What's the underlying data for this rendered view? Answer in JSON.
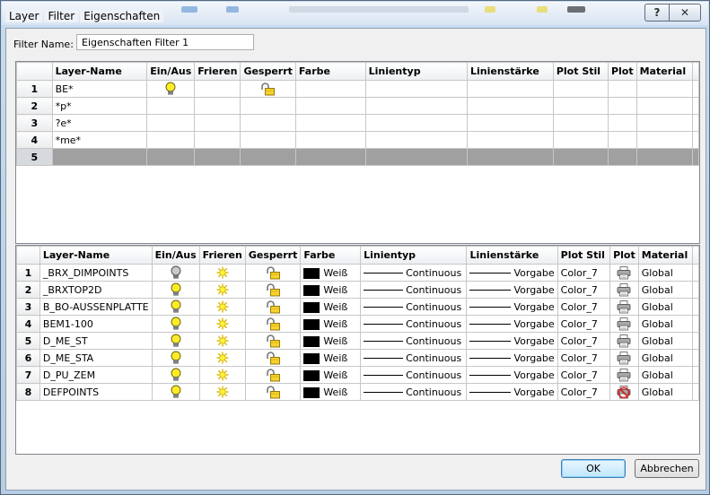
{
  "window": {
    "menu": [
      "Layer",
      "Filter",
      "Eigenschaften"
    ],
    "help_glyph": "?",
    "close_glyph": "✕"
  },
  "filter": {
    "label": "Filter Name:",
    "value": "Eigenschaften Filter 1"
  },
  "columns": [
    "Layer-Name",
    "Ein/Aus",
    "Frieren",
    "Gesperrt",
    "Farbe",
    "Linientyp",
    "Linienstärke",
    "Plot Stil",
    "Plot",
    "Material"
  ],
  "filter_rows": [
    {
      "num": "1",
      "name": "BE*",
      "on": true,
      "locked": true
    },
    {
      "num": "2",
      "name": "*p*"
    },
    {
      "num": "3",
      "name": "?e*"
    },
    {
      "num": "4",
      "name": "*me*"
    },
    {
      "num": "5",
      "name": "",
      "selected": true
    }
  ],
  "layers": [
    {
      "num": "1",
      "name": "_BRX_DIMPOINTS",
      "on": false,
      "color": "Weiß",
      "linetype": "Continuous",
      "lineweight": "Vorgabe",
      "plotstyle": "Color_7",
      "plot": true,
      "material": "Global"
    },
    {
      "num": "2",
      "name": "_BRXTOP2D",
      "on": true,
      "color": "Weiß",
      "linetype": "Continuous",
      "lineweight": "Vorgabe",
      "plotstyle": "Color_7",
      "plot": true,
      "material": "Global"
    },
    {
      "num": "3",
      "name": "B_BO-AUSSENPLATTE",
      "on": true,
      "color": "Weiß",
      "linetype": "Continuous",
      "lineweight": "Vorgabe",
      "plotstyle": "Color_7",
      "plot": true,
      "material": "Global"
    },
    {
      "num": "4",
      "name": "BEM1-100",
      "on": true,
      "color": "Weiß",
      "linetype": "Continuous",
      "lineweight": "Vorgabe",
      "plotstyle": "Color_7",
      "plot": true,
      "material": "Global"
    },
    {
      "num": "5",
      "name": "D_ME_ST",
      "on": true,
      "color": "Weiß",
      "linetype": "Continuous",
      "lineweight": "Vorgabe",
      "plotstyle": "Color_7",
      "plot": true,
      "material": "Global"
    },
    {
      "num": "6",
      "name": "D_ME_STA",
      "on": true,
      "color": "Weiß",
      "linetype": "Continuous",
      "lineweight": "Vorgabe",
      "plotstyle": "Color_7",
      "plot": true,
      "material": "Global"
    },
    {
      "num": "7",
      "name": "D_PU_ZEM",
      "on": true,
      "color": "Weiß",
      "linetype": "Continuous",
      "lineweight": "Vorgabe",
      "plotstyle": "Color_7",
      "plot": true,
      "material": "Global"
    },
    {
      "num": "8",
      "name": "DEFPOINTS",
      "on": true,
      "color": "Weiß",
      "linetype": "Continuous",
      "lineweight": "Vorgabe",
      "plotstyle": "Color_7",
      "plot": false,
      "material": "Global"
    }
  ],
  "buttons": {
    "ok": "OK",
    "cancel": "Abbrechen"
  },
  "icons": {
    "bulb_on": "lightbulb-on-icon",
    "bulb_off": "lightbulb-off-icon",
    "sun": "thaw-sun-icon",
    "lock": "padlock-icon",
    "printer": "printer-icon",
    "no_plot": "no-plot-icon"
  }
}
